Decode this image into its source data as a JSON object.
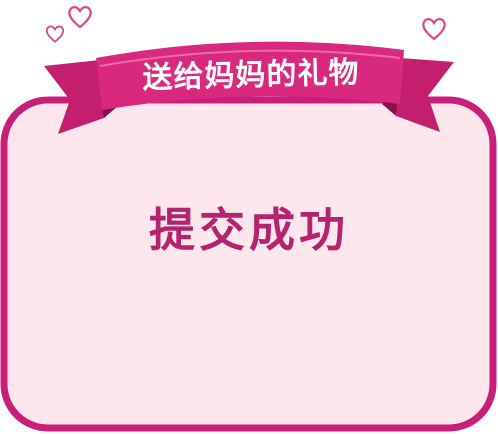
{
  "dialog": {
    "banner_title": "送给妈妈的礼物",
    "message": "提交成功"
  },
  "colors": {
    "card_fill": "#fde7ec",
    "card_border": "#c81f79",
    "ribbon_main": "#d9297f",
    "ribbon_dark": "#a0135a",
    "ribbon_mid": "#c41f6f",
    "message_text": "#b4236e",
    "heart_stroke": "#d64a86"
  },
  "icons": [
    "heart-outline-icon",
    "heart-outline-icon",
    "heart-outline-icon"
  ]
}
